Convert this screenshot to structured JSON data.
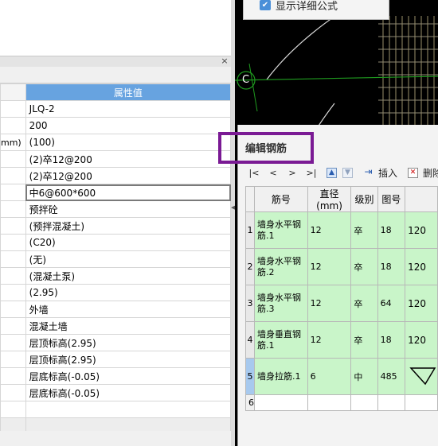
{
  "properties": {
    "header_value": "属性值",
    "truncated_unit": "mm)",
    "rows": [
      {
        "value": "JLQ-2"
      },
      {
        "value": "200"
      },
      {
        "value": "(100)"
      },
      {
        "value": "(2)卒12@200"
      },
      {
        "value": "(2)卒12@200"
      },
      {
        "value": "中6@600*600"
      },
      {
        "value": "预拌砼"
      },
      {
        "value": "(预拌混凝土)"
      },
      {
        "value": "(C20)"
      },
      {
        "value": "(无)"
      },
      {
        "value": "(混凝土泵)"
      },
      {
        "value": "(2.95)"
      },
      {
        "value": "外墙"
      },
      {
        "value": "混凝土墙"
      },
      {
        "value": "层顶标高(2.95)"
      },
      {
        "value": "层顶标高(2.95)"
      },
      {
        "value": "层底标高(-0.05)"
      },
      {
        "value": "层底标高(-0.05)"
      }
    ]
  },
  "close_label": "×",
  "cad": {
    "popup_checkbox_label": "显示详细公式",
    "axis_label": "C"
  },
  "dialog": {
    "title": "编辑钢筋",
    "nav": [
      "|<",
      "<",
      ">",
      ">|"
    ],
    "insert_label": "插入",
    "delete_label": "删除",
    "columns": [
      "筋号",
      "直径(mm)",
      "级别",
      "图号",
      ""
    ],
    "rows": [
      {
        "num": "1",
        "name": "墙身水平钢筋.1",
        "diameter": "12",
        "grade": "卒",
        "fig": "18",
        "extra": "120"
      },
      {
        "num": "2",
        "name": "墙身水平钢筋.2",
        "diameter": "12",
        "grade": "卒",
        "fig": "18",
        "extra": "120"
      },
      {
        "num": "3",
        "name": "墙身水平钢筋.3",
        "diameter": "12",
        "grade": "卒",
        "fig": "64",
        "extra": "120"
      },
      {
        "num": "4",
        "name": "墙身垂直钢筋.1",
        "diameter": "12",
        "grade": "卒",
        "fig": "18",
        "extra": "120"
      },
      {
        "num": "5",
        "name": "墙身拉筋.1",
        "diameter": "6",
        "grade": "中",
        "fig": "485",
        "extra": ""
      }
    ],
    "empty_row_num": "6"
  },
  "colors": {
    "header_blue": "#67a3e0",
    "row_green": "#c9f5c9",
    "highlight_purple": "#7a1a94"
  }
}
